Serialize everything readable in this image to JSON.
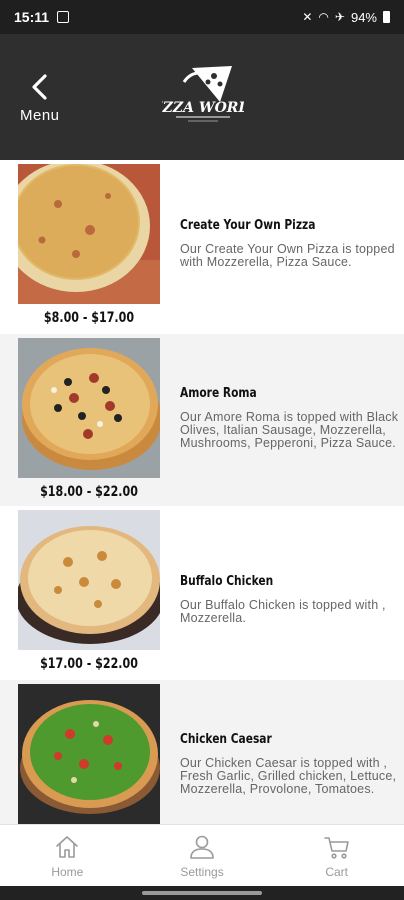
{
  "status_bar": {
    "time": "15:11",
    "battery": "94%"
  },
  "header": {
    "back_label": "Menu",
    "logo_text": "PIZZA WORLD"
  },
  "items": [
    {
      "name": "Create Your Own Pizza",
      "description": "Our Create Your Own Pizza is topped with Mozzerella, Pizza Sauce.",
      "price": "$8.00 - $17.00"
    },
    {
      "name": "Amore Roma",
      "description": "Our Amore Roma is topped with Black Olives, Italian Sausage, Mozzerella, Mushrooms, Pepperoni, Pizza Sauce.",
      "price": "$18.00 - $22.00"
    },
    {
      "name": "Buffalo Chicken",
      "description": "Our Buffalo Chicken is topped with , Mozzerella.",
      "price": "$17.00 - $22.00"
    },
    {
      "name": "Chicken Caesar",
      "description": "Our Chicken Caesar is topped with , Fresh Garlic, Grilled chicken, Lettuce, Mozzerella, Provolone, Tomatoes.",
      "price": ""
    }
  ],
  "bottom_nav": {
    "home": "Home",
    "settings": "Settings",
    "cart": "Cart"
  },
  "colors": {
    "header_bg": "#2f2f2f",
    "status_bg": "#1f1f1f",
    "alt_row_bg": "#f3f3f3",
    "nav_icon": "#9a9a9a"
  }
}
